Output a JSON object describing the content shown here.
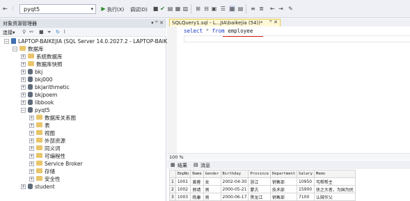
{
  "toolbar": {
    "database": "pyqt5",
    "execute_label": "执行(X)",
    "debug_label": "调试(D)"
  },
  "explorer": {
    "title": "对象资源管理器",
    "pins": "▾ ꟸ ✕",
    "connect_label": "连接▾",
    "nodes": [
      {
        "label": "LAPTOP-BAIKEJIA (SQL Server 14.0.2027.2 - LAPTOP-BAIKE",
        "icon": "server-icon"
      },
      {
        "label": "数据库",
        "icon": "folder-icon"
      },
      {
        "label": "系统数据库",
        "icon": "folder-icon"
      },
      {
        "label": "数据库快照",
        "icon": "folder-icon"
      },
      {
        "label": "bkj",
        "icon": "database-icon"
      },
      {
        "label": "bkj000",
        "icon": "database-icon"
      },
      {
        "label": "bkjarithmetic",
        "icon": "database-icon"
      },
      {
        "label": "bkjpoem",
        "icon": "database-icon"
      },
      {
        "label": "libbook",
        "icon": "database-icon"
      },
      {
        "label": "pyqt5",
        "icon": "database-icon"
      },
      {
        "label": "数据库关系图",
        "icon": "folder-icon"
      },
      {
        "label": "表",
        "icon": "folder-icon"
      },
      {
        "label": "视图",
        "icon": "folder-icon"
      },
      {
        "label": "外部资源",
        "icon": "folder-icon"
      },
      {
        "label": "同义词",
        "icon": "folder-icon"
      },
      {
        "label": "可编程性",
        "icon": "folder-icon"
      },
      {
        "label": "Service Broker",
        "icon": "folder-icon"
      },
      {
        "label": "存储",
        "icon": "folder-icon"
      },
      {
        "label": "安全性",
        "icon": "folder-icon"
      },
      {
        "label": "student",
        "icon": "database-icon"
      }
    ]
  },
  "editor": {
    "tab_label": "SQLQuery1.sql - L...JIA\\baikejia (54))*",
    "tab_close": "ꟸ ✕",
    "code": {
      "kw1": "select",
      "star": " * ",
      "kw2": "from",
      "table": " employee"
    },
    "zoom": "100 %"
  },
  "results": {
    "tab_results": "结果",
    "tab_messages": "消息",
    "columns": [
      "",
      "EmpNo",
      "Name",
      "Gender",
      "Birthday",
      "Province",
      "Department",
      "Salary",
      "Memo"
    ],
    "rows": [
      [
        "1",
        "1001",
        "黄蓉",
        "女",
        "2002-04-30",
        "浙江",
        "销售部",
        "10950",
        "丐帮帮主"
      ],
      [
        "2",
        "1002",
        "郭靖",
        "男",
        "2000-05-21",
        "蒙古",
        "技术部",
        "15900",
        "侠之大者，为国为民"
      ],
      [
        "3",
        "1003",
        "杨康",
        "男",
        "2000-06-17",
        "黑龙江",
        "销售部",
        "7100",
        "认贼作父"
      ]
    ]
  }
}
